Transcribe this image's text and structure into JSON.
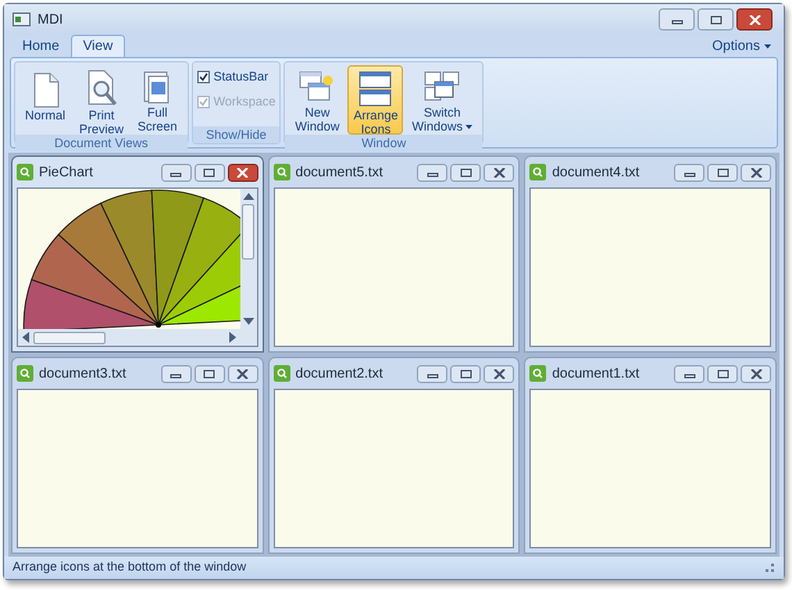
{
  "window": {
    "title": "MDI"
  },
  "tabs": [
    {
      "label": "Home",
      "selected": false
    },
    {
      "label": "View",
      "selected": true
    }
  ],
  "options": {
    "label": "Options"
  },
  "ribbon": {
    "groups": [
      {
        "title": "Document Views",
        "items": [
          {
            "kind": "button",
            "lines": [
              "Normal"
            ],
            "selected": false
          },
          {
            "kind": "button",
            "lines": [
              "Print",
              "Preview"
            ],
            "selected": false
          },
          {
            "kind": "button",
            "lines": [
              "Full",
              "Screen"
            ],
            "selected": false
          }
        ]
      },
      {
        "title": "Show/Hide",
        "items": [
          {
            "kind": "checkbox",
            "label": "StatusBar",
            "checked": true,
            "disabled": false
          },
          {
            "kind": "checkbox",
            "label": "Workspace",
            "checked": true,
            "disabled": true
          }
        ]
      },
      {
        "title": "Window",
        "items": [
          {
            "kind": "button",
            "lines": [
              "New",
              "Window"
            ],
            "selected": false
          },
          {
            "kind": "button",
            "lines": [
              "Arrange",
              "Icons"
            ],
            "selected": true
          },
          {
            "kind": "button",
            "lines": [
              "Switch",
              "Windows"
            ],
            "selected": false,
            "dropdown": true
          }
        ]
      }
    ]
  },
  "children": [
    {
      "title": "PieChart",
      "kind": "chart",
      "active": true
    },
    {
      "title": "document5.txt",
      "kind": "text",
      "active": false
    },
    {
      "title": "document4.txt",
      "kind": "text",
      "active": false
    },
    {
      "title": "document3.txt",
      "kind": "text",
      "active": false
    },
    {
      "title": "document2.txt",
      "kind": "text",
      "active": false
    },
    {
      "title": "document1.txt",
      "kind": "text",
      "active": false
    }
  ],
  "status_bar": {
    "text": "Arrange icons at the bottom of the window"
  }
}
